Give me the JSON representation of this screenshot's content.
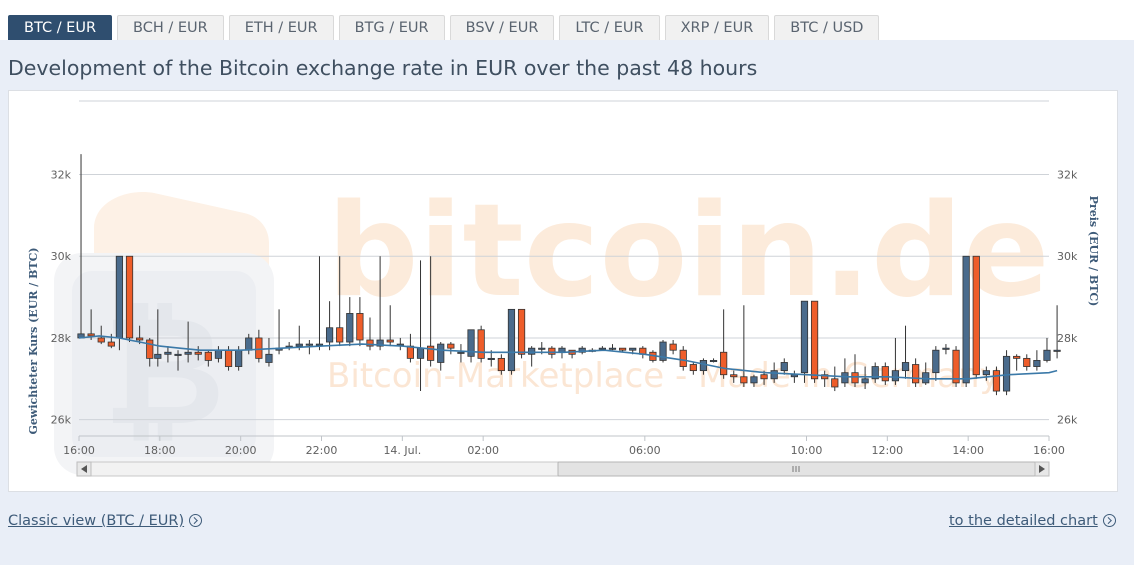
{
  "tabs": [
    {
      "label": "BTC / EUR",
      "active": true
    },
    {
      "label": "BCH / EUR",
      "active": false
    },
    {
      "label": "ETH / EUR",
      "active": false
    },
    {
      "label": "BTG / EUR",
      "active": false
    },
    {
      "label": "BSV / EUR",
      "active": false
    },
    {
      "label": "LTC / EUR",
      "active": false
    },
    {
      "label": "XRP / EUR",
      "active": false
    },
    {
      "label": "BTC / USD",
      "active": false
    }
  ],
  "page_title": "Development of the Bitcoin exchange rate in EUR over the past 48 hours",
  "links": {
    "classic_view": "Classic view (BTC / EUR)",
    "detailed_chart": "to the detailed chart"
  },
  "watermark": {
    "brand": "bitcoin.de",
    "tagline": "Bitcoin-Marketplace - Made in Germany!"
  },
  "colors": {
    "up": "#4a6b8c",
    "down": "#ee5d2a",
    "average_line": "#3b79a8",
    "tab_active": "#2f4e6f"
  },
  "chart_data": {
    "type": "candlestick",
    "title": "",
    "ylabel_left": "Gewichteter Kurs (EUR / BTC)",
    "ylabel_right": "Preis (EUR / BTC)",
    "yticks": [
      "26k",
      "28k",
      "30k",
      "32k"
    ],
    "ylim": [
      25600,
      33800
    ],
    "x_ticks": [
      {
        "label": "16:00",
        "t": 16
      },
      {
        "label": "18:00",
        "t": 18
      },
      {
        "label": "20:00",
        "t": 20
      },
      {
        "label": "22:00",
        "t": 22
      },
      {
        "label": "14. Jul.",
        "t": 24
      },
      {
        "label": "02:00",
        "t": 26
      },
      {
        "label": "06:00",
        "t": 30
      },
      {
        "label": "10:00",
        "t": 34
      },
      {
        "label": "12:00",
        "t": 36
      },
      {
        "label": "14:00",
        "t": 38
      },
      {
        "label": "16:00",
        "t": 40
      }
    ],
    "xlim": [
      16,
      40
    ],
    "candles": [
      [
        16.05,
        28000,
        28100,
        28050,
        32500
      ],
      [
        16.3,
        28100,
        28050,
        27950,
        28700
      ],
      [
        16.55,
        28000,
        27900,
        27850,
        28300
      ],
      [
        16.8,
        27900,
        27800,
        27750,
        28100
      ],
      [
        17.0,
        28000,
        30000,
        27700,
        30000
      ],
      [
        17.25,
        30000,
        28000,
        27900,
        30000
      ],
      [
        17.5,
        28000,
        27950,
        27850,
        28300
      ],
      [
        17.75,
        27950,
        27500,
        27300,
        28000
      ],
      [
        17.95,
        27500,
        27600,
        27300,
        28700
      ],
      [
        18.2,
        27600,
        27650,
        27400,
        27800
      ],
      [
        18.45,
        27600,
        27600,
        27200,
        27700
      ],
      [
        18.7,
        27600,
        27650,
        27400,
        28400
      ],
      [
        18.95,
        27650,
        27600,
        27450,
        27800
      ],
      [
        19.2,
        27650,
        27450,
        27300,
        27700
      ],
      [
        19.45,
        27500,
        27700,
        27400,
        27800
      ],
      [
        19.7,
        27700,
        27300,
        27200,
        27800
      ],
      [
        19.95,
        27300,
        27700,
        27200,
        27800
      ],
      [
        20.2,
        27700,
        28000,
        27600,
        28100
      ],
      [
        20.45,
        28000,
        27500,
        27400,
        28200
      ],
      [
        20.7,
        27400,
        27600,
        27300,
        28000
      ],
      [
        20.95,
        27700,
        27750,
        27600,
        28700
      ],
      [
        21.2,
        27800,
        27800,
        27700,
        27900
      ],
      [
        21.45,
        27800,
        27850,
        27700,
        28300
      ],
      [
        21.7,
        27850,
        27850,
        27600,
        27950
      ],
      [
        21.95,
        27850,
        27850,
        27700,
        30000
      ],
      [
        22.2,
        27900,
        28250,
        27700,
        28900
      ],
      [
        22.45,
        28250,
        27900,
        27800,
        30000
      ],
      [
        22.7,
        27900,
        28600,
        27800,
        29000
      ],
      [
        22.95,
        28600,
        27950,
        27800,
        29000
      ],
      [
        23.2,
        27950,
        27800,
        27700,
        28500
      ],
      [
        23.45,
        27800,
        27950,
        27700,
        30000
      ],
      [
        23.7,
        27950,
        27900,
        27800,
        28800
      ],
      [
        23.95,
        27850,
        27850,
        27700,
        28000
      ],
      [
        24.2,
        27800,
        27500,
        27400,
        28100
      ],
      [
        24.45,
        27500,
        27750,
        26700,
        29900
      ],
      [
        24.7,
        27800,
        27450,
        27300,
        30000
      ],
      [
        24.95,
        27400,
        27850,
        27200,
        27900
      ],
      [
        25.2,
        27850,
        27750,
        27600,
        27900
      ],
      [
        25.45,
        27650,
        27650,
        27400,
        27850
      ],
      [
        25.7,
        27550,
        28200,
        27400,
        28200
      ],
      [
        25.95,
        28200,
        27500,
        27400,
        28300
      ],
      [
        26.2,
        27500,
        27500,
        27300,
        27700
      ],
      [
        26.45,
        27500,
        27200,
        27100,
        27600
      ],
      [
        26.7,
        27200,
        28700,
        27100,
        28700
      ],
      [
        26.95,
        28700,
        27600,
        27500,
        28700
      ],
      [
        27.2,
        27600,
        27750,
        27300,
        27800
      ],
      [
        27.45,
        27750,
        27750,
        27600,
        27900
      ],
      [
        27.7,
        27750,
        27600,
        27500,
        27800
      ],
      [
        27.95,
        27650,
        27750,
        27500,
        27800
      ],
      [
        28.2,
        27700,
        27600,
        27500,
        27700
      ],
      [
        28.45,
        27650,
        27750,
        27600,
        27800
      ],
      [
        28.7,
        27700,
        27700,
        27650,
        27750
      ],
      [
        28.95,
        27750,
        27750,
        27700,
        27800
      ],
      [
        29.2,
        27750,
        27750,
        27700,
        27850
      ],
      [
        29.45,
        27750,
        27700,
        27650,
        27750
      ],
      [
        29.7,
        27700,
        27750,
        27600,
        27750
      ],
      [
        29.95,
        27750,
        27600,
        27500,
        27800
      ],
      [
        30.2,
        27650,
        27450,
        27400,
        27700
      ],
      [
        30.45,
        27450,
        27900,
        27400,
        27950
      ],
      [
        30.7,
        27850,
        27700,
        27600,
        27950
      ],
      [
        30.95,
        27700,
        27300,
        27200,
        27800
      ],
      [
        31.2,
        27350,
        27200,
        27100,
        27400
      ],
      [
        31.45,
        27200,
        27450,
        27100,
        27500
      ],
      [
        31.7,
        27450,
        27450,
        27400,
        27500
      ],
      [
        31.95,
        27650,
        27100,
        27000,
        28700
      ],
      [
        32.2,
        27100,
        27050,
        26900,
        27200
      ],
      [
        32.45,
        27050,
        26900,
        26800,
        28800
      ],
      [
        32.7,
        26900,
        27050,
        26800,
        27100
      ],
      [
        32.95,
        27100,
        27000,
        26850,
        27200
      ],
      [
        33.2,
        27000,
        27200,
        26900,
        27400
      ],
      [
        33.45,
        27200,
        27400,
        27100,
        27500
      ],
      [
        33.7,
        27050,
        27100,
        26900,
        27200
      ],
      [
        33.95,
        27150,
        28900,
        26900,
        28900
      ],
      [
        34.2,
        28900,
        27000,
        26900,
        28900
      ],
      [
        34.45,
        27100,
        27000,
        26800,
        27200
      ],
      [
        34.7,
        27000,
        26800,
        26700,
        27300
      ],
      [
        34.95,
        26900,
        27150,
        26800,
        27500
      ],
      [
        35.2,
        27150,
        26900,
        26800,
        27600
      ],
      [
        35.45,
        26900,
        27000,
        26750,
        27300
      ],
      [
        35.7,
        27000,
        27300,
        26900,
        27400
      ],
      [
        35.95,
        27300,
        26950,
        26850,
        27400
      ],
      [
        36.2,
        26950,
        27200,
        26850,
        28000
      ],
      [
        36.45,
        27200,
        27400,
        27000,
        28300
      ],
      [
        36.7,
        27350,
        26900,
        26800,
        27500
      ],
      [
        36.95,
        26900,
        27150,
        26850,
        27400
      ],
      [
        37.2,
        27150,
        27700,
        26950,
        27800
      ],
      [
        37.45,
        27750,
        27750,
        27600,
        27850
      ],
      [
        37.7,
        27700,
        26900,
        26800,
        27800
      ],
      [
        37.95,
        26900,
        30000,
        26800,
        30000
      ],
      [
        38.2,
        30000,
        27100,
        27000,
        30000
      ],
      [
        38.45,
        27100,
        27200,
        26950,
        27300
      ],
      [
        38.7,
        27200,
        26700,
        26600,
        27300
      ],
      [
        38.95,
        26700,
        27550,
        26600,
        27700
      ],
      [
        39.2,
        27550,
        27500,
        27200,
        27600
      ],
      [
        39.45,
        27500,
        27300,
        27200,
        27600
      ],
      [
        39.7,
        27300,
        27450,
        27200,
        27700
      ],
      [
        39.95,
        27450,
        27700,
        27400,
        28000
      ],
      [
        40.2,
        27700,
        27700,
        27500,
        28800
      ]
    ],
    "average": [
      [
        16.0,
        28000
      ],
      [
        16.5,
        28050
      ],
      [
        17.0,
        28000
      ],
      [
        17.5,
        27900
      ],
      [
        18.0,
        27800
      ],
      [
        18.5,
        27750
      ],
      [
        19.0,
        27700
      ],
      [
        20.0,
        27700
      ],
      [
        21.0,
        27750
      ],
      [
        22.0,
        27800
      ],
      [
        23.0,
        27850
      ],
      [
        24.0,
        27800
      ],
      [
        25.0,
        27700
      ],
      [
        26.0,
        27650
      ],
      [
        27.0,
        27650
      ],
      [
        28.0,
        27650
      ],
      [
        29.0,
        27700
      ],
      [
        30.0,
        27600
      ],
      [
        31.0,
        27450
      ],
      [
        32.0,
        27250
      ],
      [
        33.0,
        27150
      ],
      [
        34.0,
        27100
      ],
      [
        35.0,
        27050
      ],
      [
        36.0,
        27050
      ],
      [
        37.0,
        27000
      ],
      [
        38.0,
        27000
      ],
      [
        39.0,
        27100
      ],
      [
        40.0,
        27150
      ],
      [
        40.2,
        27200
      ]
    ]
  }
}
